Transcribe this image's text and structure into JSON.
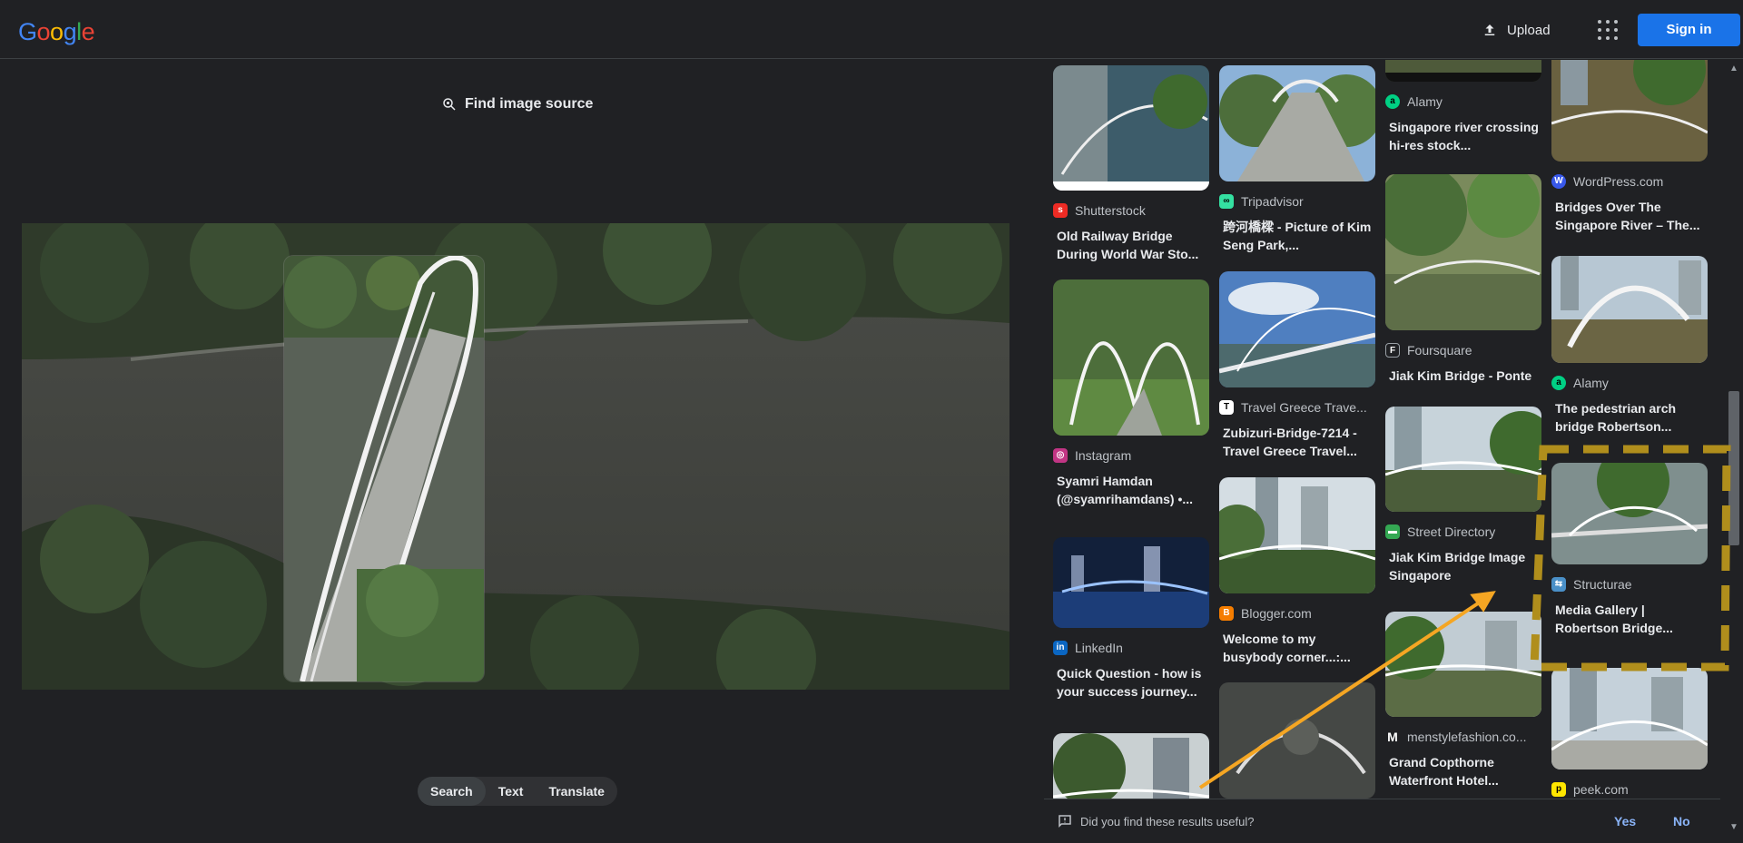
{
  "header": {
    "logo": [
      "G",
      "o",
      "o",
      "g",
      "l",
      "e"
    ],
    "logo_colors": [
      "#4285f4",
      "#ea4335",
      "#fbbc05",
      "#4285f4",
      "#34a853",
      "#ea4335"
    ],
    "upload_label": "Upload",
    "signin_label": "Sign in"
  },
  "left": {
    "find_source_label": "Find image source",
    "tabs": [
      {
        "label": "Search",
        "active": true
      },
      {
        "label": "Text",
        "active": false
      },
      {
        "label": "Translate",
        "active": false
      }
    ]
  },
  "results": [
    {
      "source": "Shutterstock",
      "title": "Old Railway Bridge During World War Sto...",
      "icon": "shutterstock-icon",
      "color": "#ee2b24"
    },
    {
      "source": "Instagram",
      "title": "Syamri Hamdan (@syamrihamdans) •...",
      "icon": "instagram-icon",
      "color": "#c13584"
    },
    {
      "source": "LinkedIn",
      "title": "Quick Question - how is your success journey...",
      "icon": "linkedin-icon",
      "color": "#0a66c2"
    },
    {
      "source": "Tripadvisor",
      "title": "跨河橋樑 - Picture of Kim Seng Park,...",
      "icon": "tripadvisor-icon",
      "color": "#34e0a1"
    },
    {
      "source": "Travel Greece Trave...",
      "title": "Zubizuri-Bridge-7214 - Travel Greece Travel...",
      "icon": "travelgreece-icon",
      "color": "#ffffff"
    },
    {
      "source": "Blogger.com",
      "title": "Welcome to my busybody corner...:...",
      "icon": "blogger-icon",
      "color": "#f57d00"
    },
    {
      "source": "Alamy",
      "title": "Singapore river crossing hi-res stock...",
      "icon": "alamy-icon",
      "color": "#00d084"
    },
    {
      "source": "Foursquare",
      "title": "Jiak Kim Bridge - Ponte",
      "icon": "foursquare-icon",
      "color": "#202124"
    },
    {
      "source": "Street Directory",
      "title": "Jiak Kim Bridge Image Singapore",
      "icon": "streetdirectory-icon",
      "color": "#34a853"
    },
    {
      "source": "menstylefashion.co...",
      "title": "Grand Copthorne Waterfront Hotel...",
      "icon": "menstyle-icon",
      "color": "#202124"
    },
    {
      "source": "WordPress.com",
      "title": "Bridges Over The Singapore River – The...",
      "icon": "wordpress-icon",
      "color": "#3858e9"
    },
    {
      "source": "Alamy",
      "title": "The pedestrian arch bridge Robertson...",
      "icon": "alamy-icon",
      "color": "#00d084"
    },
    {
      "source": "Structurae",
      "title": "Media Gallery | Robertson Bridge...",
      "icon": "structurae-icon",
      "color": "#4a90c8"
    },
    {
      "source": "peek.com",
      "title": "",
      "icon": "peek-icon",
      "color": "#ffe600"
    }
  ],
  "feedback": {
    "question": "Did you find these results useful?",
    "yes": "Yes",
    "no": "No"
  }
}
